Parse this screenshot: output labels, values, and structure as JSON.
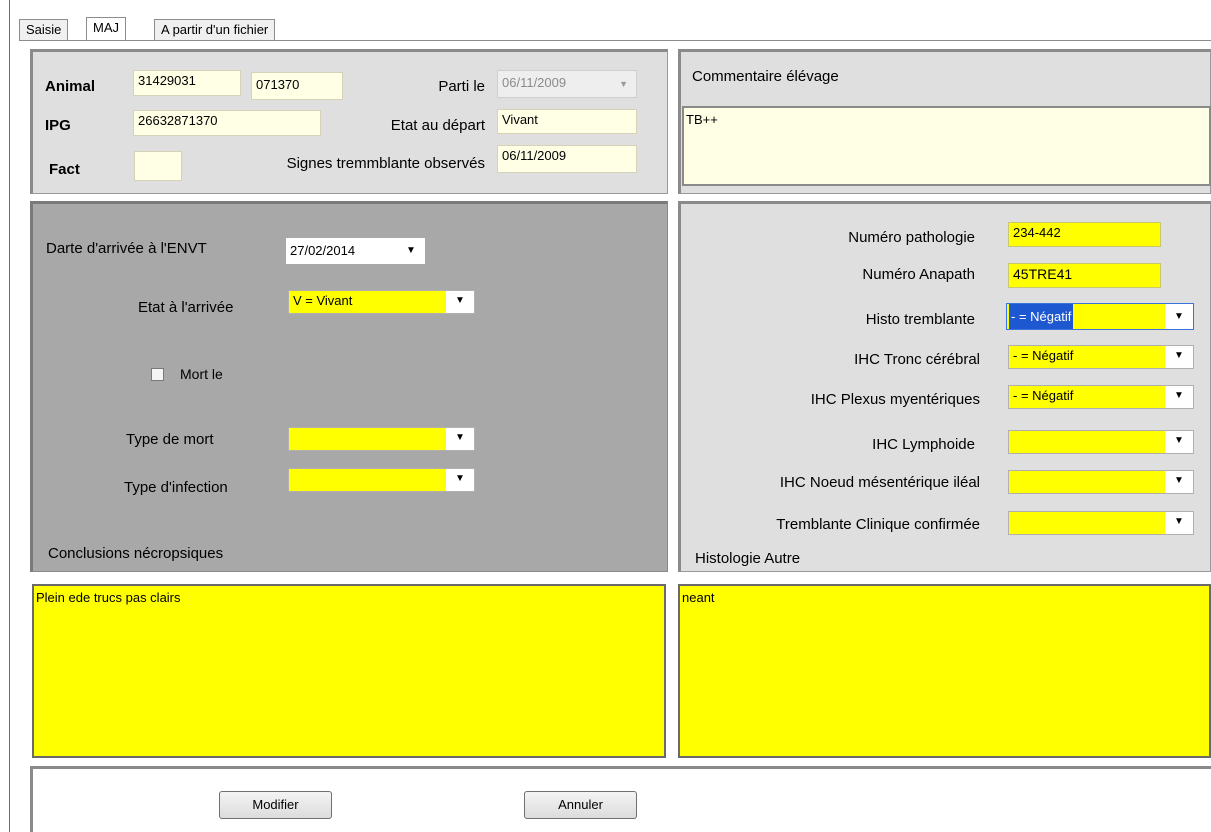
{
  "tabs": [
    {
      "label": "Saisie"
    },
    {
      "label": "MAJ"
    },
    {
      "label": "A partir d'un fichier"
    }
  ],
  "animal": {
    "animal_label": "Animal",
    "animal_num1": "31429031",
    "animal_num2": "071370",
    "ipg_label": "IPG",
    "ipg_value": "26632871370",
    "fact_label": "Fact",
    "fact_value": "",
    "parti_label": "Parti le",
    "parti_value": "06/11/2009",
    "etat_depart_label": "Etat au départ",
    "etat_depart_value": "Vivant",
    "signes_label": "Signes tremmblante observés",
    "signes_value": "06/11/2009"
  },
  "commentaire": {
    "label": "Commentaire élévage",
    "value": "TB++"
  },
  "arrivee": {
    "date_label": "Darte d'arrivée à l'ENVT",
    "date_value": "27/02/2014",
    "etat_label": "Etat à l'arrivée",
    "etat_value": "V = Vivant",
    "mort_label": "Mort le",
    "type_mort_label": "Type de mort",
    "type_mort_value": "",
    "type_infection_label": "Type d'infection",
    "type_infection_value": "",
    "conclusions_label": "Conclusions nécropsiques",
    "conclusions_value": "Plein ede trucs pas clairs"
  },
  "pathologie": {
    "num_patho_label": "Numéro pathologie",
    "num_patho_value": "234-442",
    "num_anapath_label": "Numéro Anapath",
    "num_anapath_value": "45TRE41",
    "histo_label": "Histo tremblante",
    "histo_value": "- = Négatif",
    "ihc_tronc_label": "IHC Tronc cérébral",
    "ihc_tronc_value": "- = Négatif",
    "ihc_plexus_label": "IHC Plexus myentériques",
    "ihc_plexus_value": "- = Négatif",
    "ihc_lymph_label": "IHC Lymphoide",
    "ihc_lymph_value": "",
    "ihc_noeud_label": "IHC Noeud mésentérique iléal",
    "ihc_noeud_value": "",
    "tremblante_label": "Tremblante Clinique confirmée",
    "tremblante_value": "",
    "histo_autre_label": "Histologie Autre",
    "histo_autre_value": "neant"
  },
  "buttons": {
    "modifier": "Modifier",
    "annuler": "Annuler"
  },
  "icons": {
    "dropdown": "▼"
  },
  "colors": {
    "field_yellow": "#ffff00",
    "field_pale": "#ffffe6",
    "panel_light": "#dfdfdf",
    "panel_dark": "#a8a8a8",
    "selection_blue": "#1e58d0"
  }
}
